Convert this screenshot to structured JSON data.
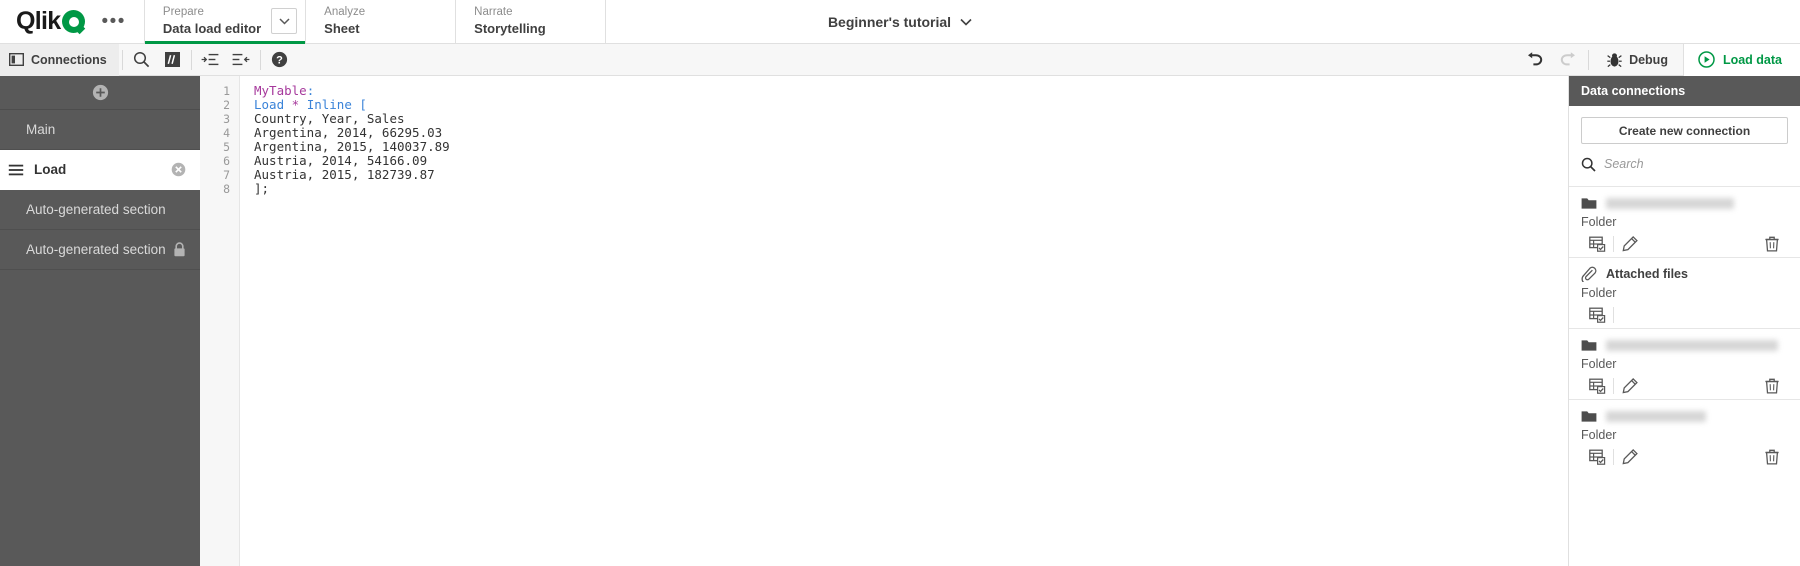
{
  "brand": {
    "name": "Qlik",
    "logo_icon": "qlik-logo",
    "accent": "#009845",
    "dark": "#595959"
  },
  "topnav": {
    "overflow_label": "•••",
    "items": [
      {
        "kicker": "Prepare",
        "title": "Data load editor",
        "active": true,
        "caret_icon": "chevron-down-icon"
      },
      {
        "kicker": "Analyze",
        "title": "Sheet",
        "active": false
      },
      {
        "kicker": "Narrate",
        "title": "Storytelling",
        "active": false
      }
    ],
    "app_title": "Beginner's tutorial",
    "app_title_caret_icon": "chevron-down-icon"
  },
  "toolbar": {
    "connections_label": "Connections",
    "connections_icon": "panel-toggle-icon",
    "search_icon": "search-icon",
    "comment_icon": "comment-icon",
    "indent_icon": "indent-icon",
    "outdent_icon": "outdent-icon",
    "help_icon": "help-icon",
    "undo_icon": "undo-icon",
    "redo_icon": "redo-icon",
    "debug_label": "Debug",
    "debug_icon": "bug-icon",
    "load_label": "Load data",
    "load_icon": "play-circle-icon"
  },
  "sidebar": {
    "add_icon": "add-section-icon",
    "sections": [
      {
        "label": "Main",
        "active": false,
        "locked": false,
        "closable": false
      },
      {
        "label": "Load",
        "active": true,
        "locked": false,
        "closable": true,
        "drag_icon": "drag-handle-icon",
        "close_icon": "close-circle-icon"
      },
      {
        "label": "Auto-generated section",
        "active": false,
        "locked": false,
        "closable": false
      },
      {
        "label": "Auto-generated section",
        "active": false,
        "locked": true,
        "closable": false,
        "lock_icon": "lock-icon"
      }
    ]
  },
  "editor": {
    "line_numbers": [
      "1",
      "2",
      "3",
      "4",
      "5",
      "6",
      "7",
      "8"
    ],
    "lines": [
      {
        "tokens": [
          {
            "t": "MyTable",
            "c": "tok-table"
          },
          {
            "t": ":",
            "c": "tok-punc"
          }
        ]
      },
      {
        "tokens": [
          {
            "t": "Load",
            "c": "tok-kw"
          },
          {
            "t": " ",
            "c": ""
          },
          {
            "t": "*",
            "c": "tok-op"
          },
          {
            "t": " ",
            "c": ""
          },
          {
            "t": "Inline",
            "c": "tok-kw"
          },
          {
            "t": " ",
            "c": ""
          },
          {
            "t": "[",
            "c": "tok-punc"
          }
        ]
      },
      {
        "tokens": [
          {
            "t": "Country, Year, Sales",
            "c": ""
          }
        ]
      },
      {
        "tokens": [
          {
            "t": "Argentina, 2014, 66295.03",
            "c": ""
          }
        ]
      },
      {
        "tokens": [
          {
            "t": "Argentina, 2015, 140037.89",
            "c": ""
          }
        ]
      },
      {
        "tokens": [
          {
            "t": "Austria, 2014, 54166.09",
            "c": ""
          }
        ]
      },
      {
        "tokens": [
          {
            "t": "Austria, 2015, 182739.87",
            "c": ""
          }
        ]
      },
      {
        "tokens": [
          {
            "t": "];",
            "c": ""
          }
        ]
      }
    ]
  },
  "data_connections": {
    "panel_title": "Data connections",
    "create_label": "Create new connection",
    "search_placeholder": "Search",
    "search_value": "",
    "search_icon": "search-icon",
    "type_label": "Folder",
    "items": [
      {
        "name": "",
        "name_blurred": true,
        "blur_width": 128,
        "type": "Folder",
        "icon": "folder-icon",
        "actions": [
          "select-data-icon",
          "edit-icon",
          "delete-icon"
        ]
      },
      {
        "name": "Attached files",
        "name_blurred": false,
        "type": "Folder",
        "icon": "paperclip-icon",
        "actions": [
          "select-data-icon"
        ]
      },
      {
        "name": "",
        "name_blurred": true,
        "blur_width": 172,
        "type": "Folder",
        "icon": "folder-icon",
        "actions": [
          "select-data-icon",
          "edit-icon",
          "delete-icon"
        ]
      },
      {
        "name": "",
        "name_blurred": true,
        "blur_width": 100,
        "type": "Folder",
        "icon": "folder-icon",
        "actions": [
          "select-data-icon",
          "edit-icon",
          "delete-icon"
        ]
      }
    ]
  }
}
